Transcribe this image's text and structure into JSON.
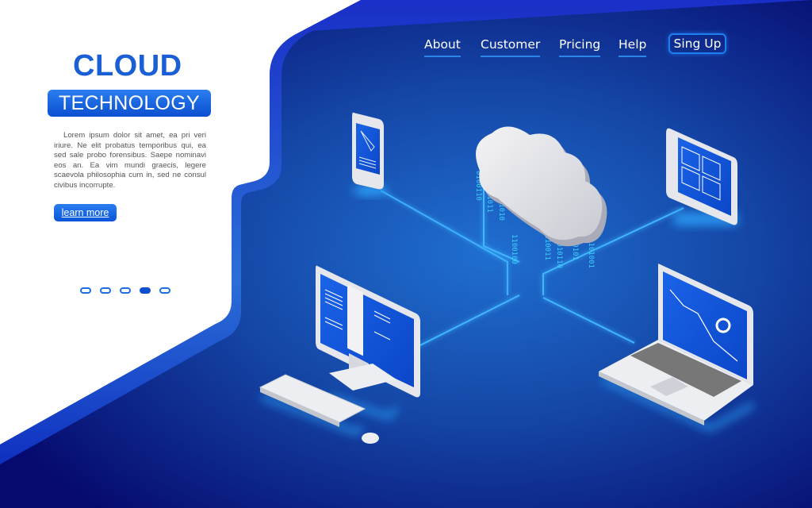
{
  "hero": {
    "title_line1": "CLOUD",
    "title_line2": "TECHNOLOGY",
    "description": "Lorem ipsum dolor sit amet, ea pri veri iriure. Ne elit probatus temporibus qui, ea sed sale probo forensibus. Saepe nominavi eos an. Ea vim mundi graecis, legere scaevola philosophia cum in, sed ne consul civibus incorrupte.",
    "cta_label": "learn more"
  },
  "nav": {
    "items": [
      {
        "label": "About"
      },
      {
        "label": "Customer"
      },
      {
        "label": "Pricing"
      },
      {
        "label": "Help"
      }
    ],
    "signup_label": "Sing Up"
  },
  "carousel": {
    "total": 5,
    "active_index": 3
  },
  "illustration": {
    "binary_streams": [
      "0 1 0 0 1 1 0",
      "1 0 0 1 0 1 1",
      "0 0 1 1 0 1 0",
      "1 1 0 0 1 0 0",
      "0 1 1 0 0 1 1",
      "1 0 1 0 1 1 0",
      "0 0 1 0 1 0 1",
      "1 1 0 1 0 0 1"
    ],
    "devices": [
      "smartphone",
      "tablet",
      "desktop-monitor",
      "laptop"
    ]
  },
  "colors": {
    "brand_blue": "#1a5fd6",
    "accent_glow": "#2fa8ff",
    "bg_dark": "#040a6e",
    "bg_mid": "#1553b8"
  }
}
